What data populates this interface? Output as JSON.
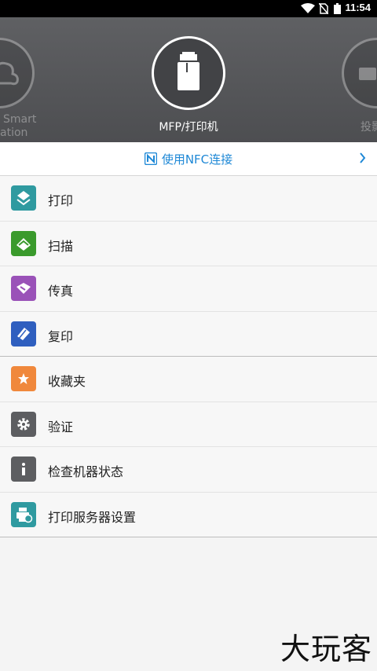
{
  "status_bar": {
    "time": "11:54"
  },
  "carousel": {
    "left_device_label": [
      "Smart",
      "ation"
    ],
    "center_device_label": "MFP/打印机",
    "right_device_label": "投影"
  },
  "nfc": {
    "label": "使用NFC连接",
    "color": "#1e88d6"
  },
  "menu": {
    "items": [
      {
        "label": "打印",
        "icon": "print-icon",
        "color": "#2f9aa0"
      },
      {
        "label": "扫描",
        "icon": "scan-icon",
        "color": "#3a9a2c"
      },
      {
        "label": "传真",
        "icon": "fax-icon",
        "color": "#9a52b8"
      },
      {
        "label": "复印",
        "icon": "copy-icon",
        "color": "#2f5fbf"
      },
      {
        "label": "收藏夹",
        "icon": "star-icon",
        "color": "#f0883c"
      },
      {
        "label": "验证",
        "icon": "gear-icon",
        "color": "#5d5e61"
      },
      {
        "label": "检查机器状态",
        "icon": "info-icon",
        "color": "#5d5e61"
      },
      {
        "label": "打印服务器设置",
        "icon": "print-server-icon",
        "color": "#2f9aa0"
      }
    ]
  },
  "watermark": "大玩客"
}
